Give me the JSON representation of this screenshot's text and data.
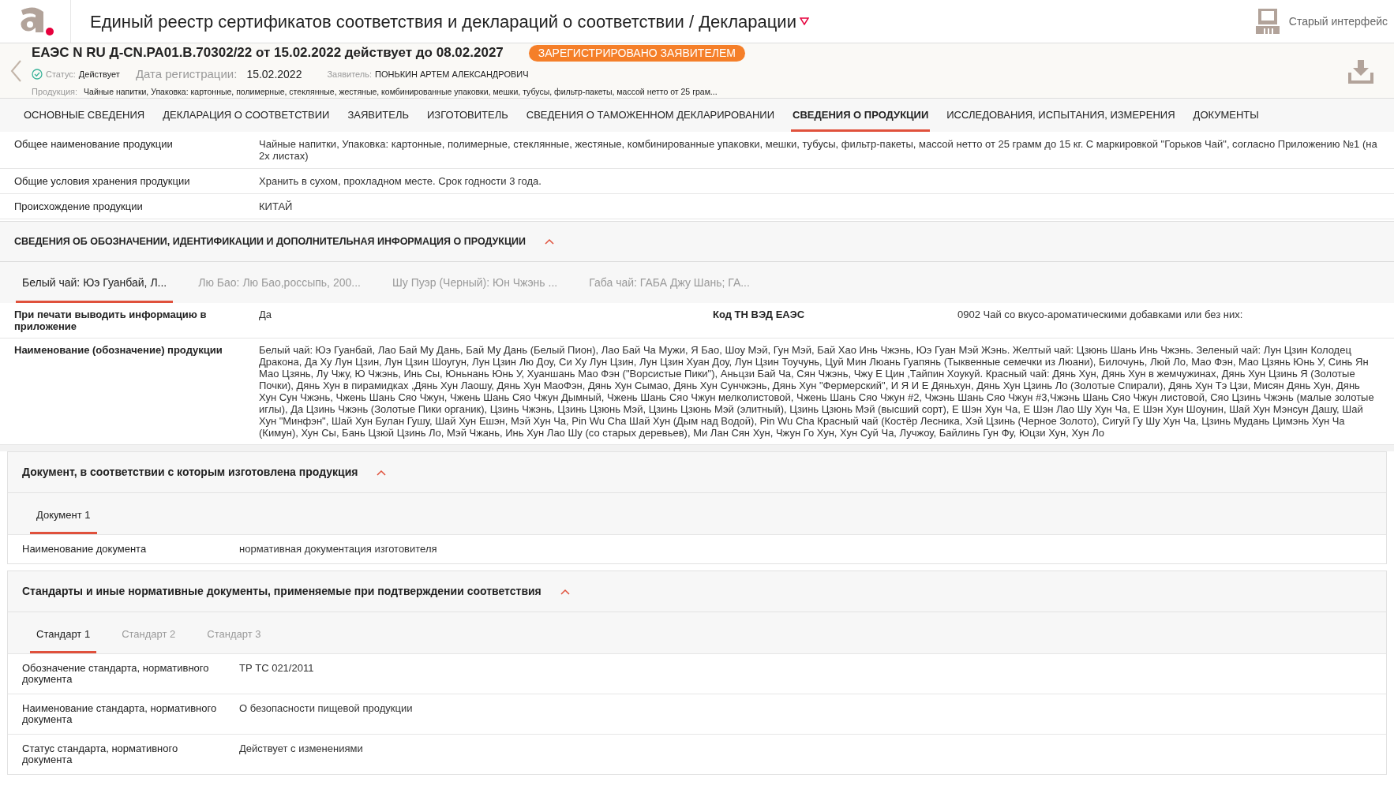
{
  "header": {
    "title": "Единый реестр сертификатов соответствия и деклараций о соответствии / Декларации",
    "old_ui_label": "Старый интерфейс"
  },
  "record": {
    "number_line": "ЕАЭС N RU Д-CN.РА01.В.70302/22 от 15.02.2022 действует до 08.02.2027",
    "badge": "ЗАРЕГИСТРИРОВАНО ЗАЯВИТЕЛЕМ",
    "status_label": "Статус:",
    "status": "Действует",
    "reg_date_label": "Дата регистрации:",
    "reg_date": "15.02.2022",
    "applicant_label": "Заявитель:",
    "applicant": "ПОНЬКИН АРТЕМ АЛЕКСАНДРОВИЧ",
    "product_label": "Продукция:",
    "product": "Чайные напитки, Упаковка: картонные, полимерные, стеклянные, жестяные, комбинированные упаковки, мешки, тубусы, фильтр-пакеты, массой нетто от 25 грам..."
  },
  "tabs": [
    {
      "label": "ОСНОВНЫЕ СВЕДЕНИЯ",
      "selected": false
    },
    {
      "label": "ДЕКЛАРАЦИЯ О СООТВЕТСТВИИ",
      "selected": false
    },
    {
      "label": "ЗАЯВИТЕЛЬ",
      "selected": false
    },
    {
      "label": "ИЗГОТОВИТЕЛЬ",
      "selected": false
    },
    {
      "label": "СВЕДЕНИЯ О ТАМОЖЕННОМ ДЕКЛАРИРОВАНИИ",
      "selected": false
    },
    {
      "label": "СВЕДЕНИЯ О ПРОДУКЦИИ",
      "selected": true
    },
    {
      "label": "ИССЛЕДОВАНИЯ, ИСПЫТАНИЯ, ИЗМЕРЕНИЯ",
      "selected": false
    },
    {
      "label": "ДОКУМЕНТЫ",
      "selected": false
    }
  ],
  "general_rows": [
    {
      "label": "Общее наименование продукции",
      "value": "Чайные напитки, Упаковка: картонные, полимерные, стеклянные, жестяные, комбинированные упаковки, мешки, тубусы, фильтр-пакеты, массой нетто от 25 грамм до 15 кг. С маркировкой \"Горьков Чай\", согласно Приложению №1 (на 2х листах)"
    },
    {
      "label": "Общие условия хранения продукции",
      "value": "Хранить в сухом, прохладном месте. Срок годности 3 года."
    },
    {
      "label": "Происхождение продукции",
      "value": "КИТАЙ"
    }
  ],
  "identification": {
    "title": "СВЕДЕНИЯ ОБ ОБОЗНАЧЕНИИ, ИДЕНТИФИКАЦИИ И ДОПОЛНИТЕЛЬНАЯ ИНФОРМАЦИЯ О ПРОДУКЦИИ",
    "expanded": true,
    "subtabs": [
      {
        "label": "Белый чай: Юэ Гуанбай, Л...",
        "selected": true
      },
      {
        "label": "Лю Бао: Лю Бао,россыпь, 200...",
        "selected": false
      },
      {
        "label": "Шу Пуэр (Черный): Юн Чжэнь ...",
        "selected": false
      },
      {
        "label": "Габа чай: ГАБА Джу Шань; ГА...",
        "selected": false
      }
    ],
    "rows": [
      {
        "fields": [
          {
            "label": "При печати выводить информацию в приложение",
            "value": "Да"
          },
          {
            "label": "Код ТН ВЭД ЕАЭС",
            "value": "0902 Чай со вкусо-ароматическими добавками или без них:"
          }
        ]
      },
      {
        "fields": [
          {
            "label": "Наименование (обозначение) продукции",
            "value": "Белый чай: Юэ Гуанбай, Лао Бай Му Дань, Бай Му Дань (Белый Пион), Лао Бай Ча Мужи, Я Бао, Шоу Мэй, Гун Мэй, Бай Хао Инь Чжэнь, Юэ Гуан Мэй Жэнь. Желтый чай: Цзюнь Шань Инь Чжэнь. Зеленый чай: Лун Цзин Колодец Дракона, Да Ху Лун Цзин, Лун Цзин Шоугун, Лун Цзин Лю Доу, Си Ху Лун Цзин, Лун Цзин Хуан Доу, Лун Цзин Тоучунь, Цуй Мин Люань Гуапянь (Тыквенные семечки из Люани), Билочунь, Люй Ло, Мао Фэн, Мао Цзянь Юнь У, Синь Ян Мао Цзянь, Лу Чжу, Ю Чжэнь, Инь Сы, Юньнань Юнь У, Хуаншань Мао Фэн (\"Ворсистые Пики\"), Аньцзи Бай Ча, Сян Чжэнь, Чжу Е Цин ,Тайпин Хоукуй. Красный чай: Дянь Хун, Дянь Хун в жемчужинах, Дянь Хун Цзинь Я (Золотые Почки), Дянь Хун в пирамидках ,Дянь Хун Лаошу, Дянь Хун МаоФэн, Дянь Хун Сымао, Дянь Хун Сунчжэнь, Дянь Хун \"Фермерский\", И Я И Е Дяньхун, Дянь Хун Цзинь Ло (Золотые Спирали), Дянь Хун Тэ Цзи, Мисян Дянь Хун, Дянь Хун Сун Чжэнь, Чжень Шань Сяо Чжун, Чжень Шань Сяо Чжун Дымный, Чжень Шань Сяо Чжун мелколистовой, Чжень Шань Сяо Чжун #2, Чжэнь Шань Сяо Чжун #3,Чжэнь Шань Сяо Чжун листовой, Сяо Цзинь Чжэнь (малые золотые иглы), Да Цзинь Чжэнь (Золотые Пики органик), Цзинь Чжэнь, Цзинь Цзюнь Мэй, Цзинь Цзюнь Мэй (элитный), Цзинь Цзюнь Мэй (высший сорт), Е Шэн Хун Ча, Е Шэн Лао Шу Хун Ча, Е Шэн Хун Шоунин, Шай Хун Мэнсун Дашу, Шай Хун \"Минфэн\", Шай Хун Булан Гушу, Шай Хун Ешэн, Мэй Хун Ча, Pin Wu Cha Шай Хун (Дым над Водой), Pin Wu Cha Красный чай (Костёр Лесника, Хэй Цзинь (Черное Золото), Сигуй Гу Шу Хун Ча, Цзинь Мудань Цимэнь Хун Ча (Кимун), Хун Сы, Бань Цзюй Цзинь Ло, Мэй Чжань, Инь Хун Лао Шу (со старых деревьев), Ми Лан Сян Хун, Чжун Го Хун, Хун Суй Ча, Лучжоу, Байлинь Гун Фу, Юцзи Хун, Хун Ло"
          }
        ]
      }
    ]
  },
  "document_section": {
    "title": "Документ, в соответствии с которым изготовлена продукция",
    "expanded": true,
    "subtabs": [
      {
        "label": "Документ 1",
        "selected": true
      }
    ],
    "rows": [
      {
        "label": "Наименование документа",
        "value": "нормативная документация изготовителя"
      }
    ]
  },
  "standards_section": {
    "title": "Стандарты и иные нормативные документы, применяемые при подтверждении соответствия",
    "expanded": true,
    "subtabs": [
      {
        "label": "Стандарт 1",
        "selected": true
      },
      {
        "label": "Стандарт 2",
        "selected": false
      },
      {
        "label": "Стандарт 3",
        "selected": false
      }
    ],
    "rows": [
      {
        "label": "Обозначение стандарта, нормативного документа",
        "value": "ТР ТС 021/2011"
      },
      {
        "label": "Наименование стандарта, нормативного документа",
        "value": "О безопасности пищевой продукции"
      },
      {
        "label": "Статус стандарта, нормативного документа",
        "value": "Действует с изменениями"
      }
    ]
  }
}
